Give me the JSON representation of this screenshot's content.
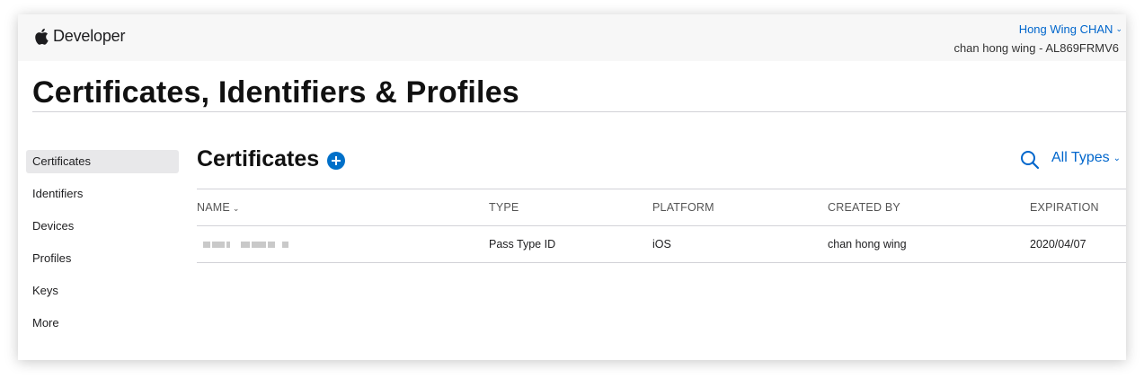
{
  "header": {
    "brand": "Developer",
    "account_name": "Hong Wing CHAN",
    "account_team": "chan hong wing - AL869FRMV6"
  },
  "page_title": "Certificates, Identifiers & Profiles",
  "sidebar": {
    "items": [
      {
        "label": "Certificates",
        "active": true
      },
      {
        "label": "Identifiers",
        "active": false
      },
      {
        "label": "Devices",
        "active": false
      },
      {
        "label": "Profiles",
        "active": false
      },
      {
        "label": "Keys",
        "active": false
      },
      {
        "label": "More",
        "active": false
      }
    ]
  },
  "main": {
    "section_title": "Certificates",
    "filter_label": "All Types",
    "table": {
      "columns": [
        "NAME",
        "TYPE",
        "PLATFORM",
        "CREATED BY",
        "EXPIRATION"
      ],
      "rows": [
        {
          "name": "",
          "type": "Pass Type ID",
          "platform": "iOS",
          "created_by": "chan hong wing",
          "expiration": "2020/04/07"
        }
      ]
    }
  },
  "colors": {
    "accent": "#0066cc",
    "add_button": "#0070c9",
    "active_sidebar_bg": "#e8e8ea"
  },
  "icons": {
    "brand": "apple-logo-icon",
    "add": "plus-circle-icon",
    "search": "search-icon",
    "dropdown": "chevron-down-icon"
  }
}
